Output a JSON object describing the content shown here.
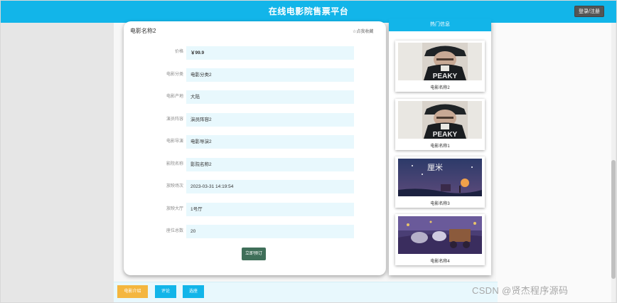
{
  "header": {
    "site_title": "在线电影院售票平台",
    "login_label": "登录/注册",
    "bar_color": "#12b5e9"
  },
  "detail": {
    "title": "电影名称2",
    "favorite_label": "☆点我收藏",
    "rows": [
      {
        "label": "价格",
        "value": "￥99.9"
      },
      {
        "label": "电影分类",
        "value": "电影分类2"
      },
      {
        "label": "电影产地",
        "value": "大陆"
      },
      {
        "label": "演员阵容",
        "value": "演员阵容2"
      },
      {
        "label": "电影导演",
        "value": "电影导演2"
      },
      {
        "label": "影院名称",
        "value": "影院名称2"
      },
      {
        "label": "放映场次",
        "value": "2023-03-31 14:19:54"
      },
      {
        "label": "放映大厅",
        "value": "1号厅"
      },
      {
        "label": "座位总数",
        "value": "20"
      }
    ],
    "book_label": "立即预订"
  },
  "hot": {
    "title": "热门信息",
    "items": [
      {
        "name": "电影名称2",
        "poster": "poster-peaky-icon"
      },
      {
        "name": "电影名称1",
        "poster": "poster-peaky-icon"
      },
      {
        "name": "电影名称3",
        "poster": "poster-lantern-night-icon"
      },
      {
        "name": "电影名称4",
        "poster": "poster-carriage-icon"
      }
    ],
    "poster_text": {
      "peaky": "PEAKY",
      "lantern": "厘米"
    }
  },
  "tabs": {
    "intro": "电影介绍",
    "comment": "评论",
    "select_seat": "选座"
  },
  "watermark": "CSDN @贤杰程序源码"
}
